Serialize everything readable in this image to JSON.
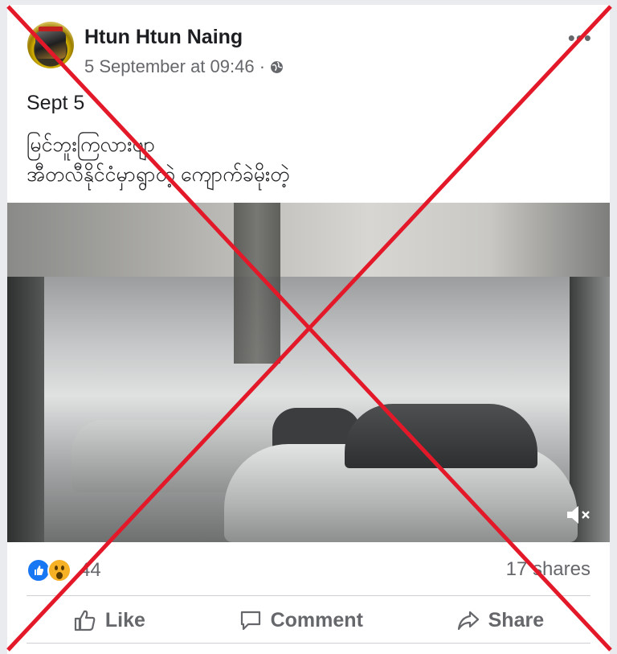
{
  "post": {
    "author": "Htun Htun Naing",
    "timestamp": "5 September at 09:46 ·",
    "text_line1": "Sept 5",
    "text_line2": "မြင်ဘူးကြလားဗျာ",
    "text_line3": "အီတလီနိုင်ငံမှာရွာတဲ့ ကျောက်ခဲမိုးတဲ့",
    "more_icon": "•••",
    "reaction_count": "44",
    "shares": "17 shares"
  },
  "actions": {
    "like": "Like",
    "comment": "Comment",
    "share": "Share"
  },
  "icons": {
    "privacy": "globe-icon",
    "mute": "speaker-muted-icon",
    "overlay": "red-x-cross"
  },
  "colors": {
    "accent": "#1877f2",
    "overlay_red": "#e3192a",
    "text_secondary": "#65676b"
  }
}
